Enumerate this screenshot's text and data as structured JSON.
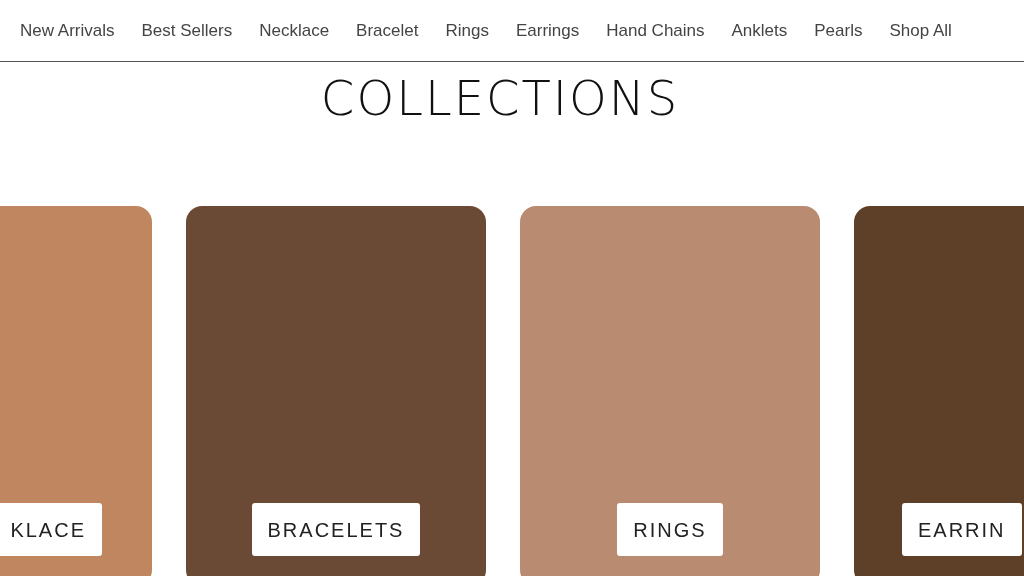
{
  "nav": {
    "items": [
      "New Arrivals",
      "Best Sellers",
      "Necklace",
      "Bracelet",
      "Rings",
      "Earrings",
      "Hand Chains",
      "Anklets",
      "Pearls",
      "Shop All"
    ]
  },
  "heading": "COLLECTIONS",
  "collections": [
    {
      "label": "KLACE"
    },
    {
      "label": "BRACELETS"
    },
    {
      "label": "RINGS"
    },
    {
      "label": "EARRIN"
    }
  ]
}
